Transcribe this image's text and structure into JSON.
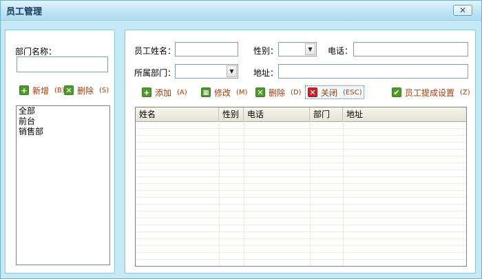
{
  "window": {
    "title": "员工管理",
    "close_glyph": "✕"
  },
  "department": {
    "name_label": "部门名称：",
    "name_value": "",
    "add": {
      "label": "新增",
      "key": "(B)"
    },
    "delete": {
      "label": "删除",
      "key": "(S)"
    },
    "items": [
      "全部",
      "前台",
      "销售部"
    ]
  },
  "employee_form": {
    "name_label": "员工姓名：",
    "gender_label": "性别：",
    "phone_label": "电话：",
    "dept_label": "所属部门：",
    "address_label": "地址："
  },
  "toolbar": {
    "add": {
      "label": "添加",
      "key": "(A)"
    },
    "edit": {
      "label": "修改",
      "key": "(M)"
    },
    "delete": {
      "label": "删除",
      "key": "(D)"
    },
    "close": {
      "label": "关闭",
      "key": "(ESC)"
    },
    "commission": {
      "label": "员工提成设置",
      "key": "(Z)"
    }
  },
  "grid": {
    "columns": [
      "姓名",
      "性别",
      "电话",
      "部门",
      "地址"
    ],
    "rows": []
  },
  "colors": {
    "accent_green": "#4f9a2d",
    "danger_red": "#c8232b",
    "frame_blue": "#c6e9f6"
  },
  "icons": {
    "add": "plus-icon",
    "delete": "x-icon",
    "edit": "grid-icon",
    "close": "x-icon",
    "settings": "check-icon"
  }
}
